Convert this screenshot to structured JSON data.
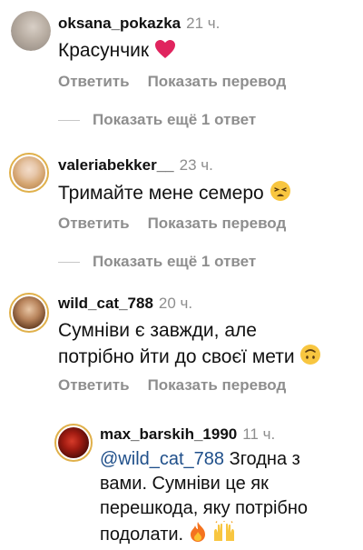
{
  "comments": [
    {
      "username": "oksana_pokazka",
      "time": "21 ч.",
      "text": "Красунчик",
      "reply_label": "Ответить",
      "translate_label": "Показать перевод",
      "more_replies": "Показать ещё 1 ответ"
    },
    {
      "username": "valeriabekker__",
      "time": "23 ч.",
      "text": "Тримайте мене семеро",
      "reply_label": "Ответить",
      "translate_label": "Показать перевод",
      "more_replies": "Показать ещё 1 ответ"
    },
    {
      "username": "wild_cat_788",
      "time": "20 ч.",
      "text_line1": "Сумніви є завжди, але",
      "text_line2": "потрібно йти до своєї мети",
      "reply_label": "Ответить",
      "translate_label": "Показать перевод"
    }
  ],
  "reply": {
    "username": "max_barskih_1990",
    "time": "11 ч.",
    "mention": "@wild_cat_788",
    "text_line1": "Згодна з",
    "text_line2": "вами. Сумніви це як",
    "text_line3": "перешкода, яку потрібно",
    "text_line4": "подолати."
  },
  "icons": {
    "heart": "red-heart-emoji",
    "tired_face": "tired-face-emoji",
    "upside_down": "upside-down-face-emoji",
    "fire": "fire-emoji",
    "raised_hands": "raised-hands-emoji"
  },
  "colors": {
    "text": "#111111",
    "secondary": "#8e8e8e",
    "mention": "#1f4f8a",
    "heart": "#e0245e"
  }
}
